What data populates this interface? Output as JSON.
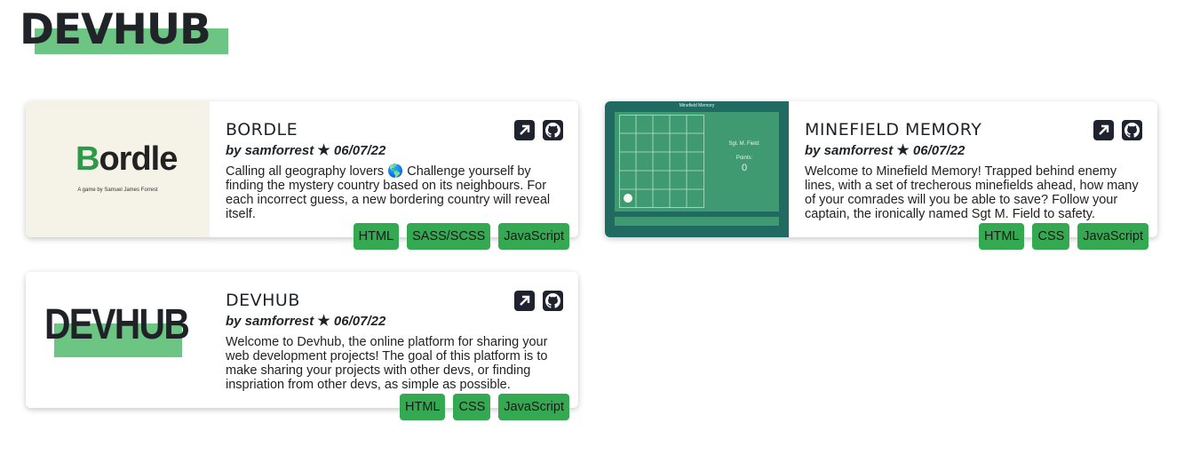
{
  "header": {
    "logo_text": "DEVHUB"
  },
  "accent_color": "#35a852",
  "icons": {
    "link": "external-link-icon",
    "repo": "github-icon",
    "star": "star-icon"
  },
  "cards": [
    {
      "title": "BORDLE",
      "author": "by samforrest",
      "date": "06/07/22",
      "description": "Calling all geography lovers 🌎 Challenge yourself by finding the mystery country based on its neighbours. For each incorrect guess, a new bordering country will reveal itself.",
      "thumb": {
        "logo_first": "B",
        "logo_rest": "ordle",
        "subtitle": "A game by Samuel James Forrest"
      },
      "tags": [
        "HTML",
        "SASS/SCSS",
        "JavaScript"
      ]
    },
    {
      "title": "MINEFIELD MEMORY",
      "author": "by samforrest",
      "date": "06/07/22",
      "description": "Welcome to Minefield Memory! Trapped behind enemy lines, with a set of trecherous minefields ahead, how many of your comrades will you be able to save? Follow your captain, the ironically named Sgt M. Field to safety.",
      "thumb": {
        "title": "Minefield Memory",
        "captain": "Sgt. M. Field:",
        "points_label": "Points:",
        "points_value": "0"
      },
      "tags": [
        "HTML",
        "CSS",
        "JavaScript"
      ]
    },
    {
      "title": "DEVHUB",
      "author": "by samforrest",
      "date": "06/07/22",
      "description": "Welcome to Devhub, the online platform for sharing your web development projects! The goal of this platform is to make sharing your projects with other devs, or finding inspriation from other devs, as simple as possible.",
      "thumb": {
        "logo_text": "DEVHUB"
      },
      "tags": [
        "HTML",
        "CSS",
        "JavaScript"
      ]
    }
  ]
}
